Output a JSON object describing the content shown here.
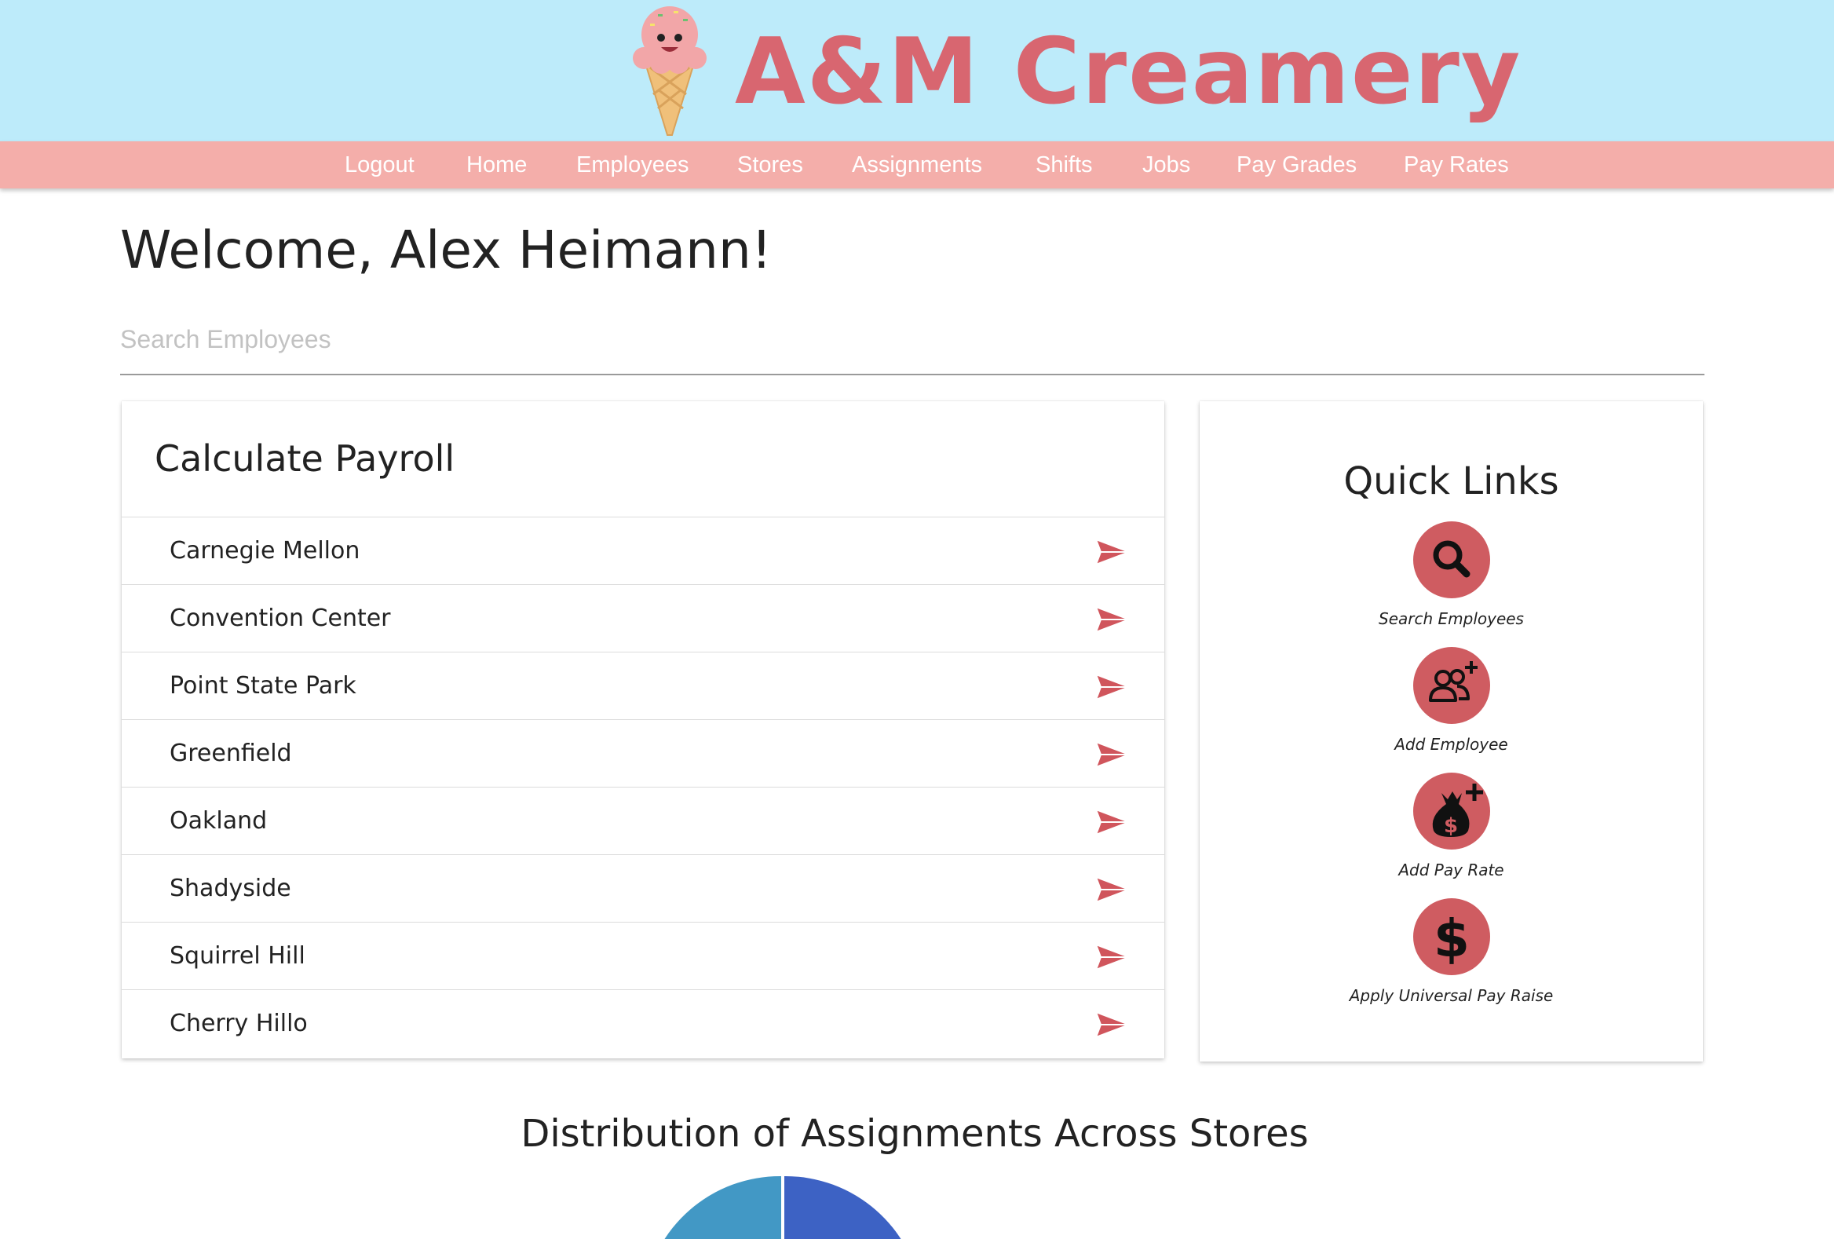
{
  "brand": {
    "name": "A&M Creamery",
    "logo": "ice-cream-cone-mascot",
    "colors": {
      "header_bg": "#bdebfa",
      "brand_text": "#d86670",
      "nav_bg": "#f4aeaa",
      "accent": "#cf5c61"
    }
  },
  "nav": {
    "items": [
      {
        "label": "Logout"
      },
      {
        "label": "Home"
      },
      {
        "label": "Employees"
      },
      {
        "label": "Stores"
      },
      {
        "label": "Assignments"
      },
      {
        "label": "Shifts"
      },
      {
        "label": "Jobs"
      },
      {
        "label": "Pay Grades"
      },
      {
        "label": "Pay Rates"
      }
    ]
  },
  "welcome": {
    "text": "Welcome, Alex Heimann!"
  },
  "search": {
    "placeholder": "Search Employees",
    "value": ""
  },
  "payroll": {
    "title": "Calculate Payroll",
    "icon": "send-arrow-icon",
    "stores": [
      {
        "name": "Carnegie Mellon"
      },
      {
        "name": "Convention Center"
      },
      {
        "name": "Point State Park"
      },
      {
        "name": "Greenfield"
      },
      {
        "name": "Oakland"
      },
      {
        "name": "Shadyside"
      },
      {
        "name": "Squirrel Hill"
      },
      {
        "name": "Cherry Hillo"
      }
    ]
  },
  "quick_links": {
    "title": "Quick Links",
    "items": [
      {
        "label": "Search Employees",
        "icon": "magnifier-icon"
      },
      {
        "label": "Add Employee",
        "icon": "add-user-group-icon"
      },
      {
        "label": "Add Pay Rate",
        "icon": "money-bag-plus-icon"
      },
      {
        "label": "Apply Universal Pay Raise",
        "icon": "dollar-sign-icon"
      }
    ]
  },
  "chart_data": {
    "type": "pie",
    "title": "Distribution of Assignments Across Stores",
    "colors": [
      "#4298c5",
      "#3d62c4"
    ],
    "note_visible": "only the top of the pie is visible; slice values are not legible"
  }
}
